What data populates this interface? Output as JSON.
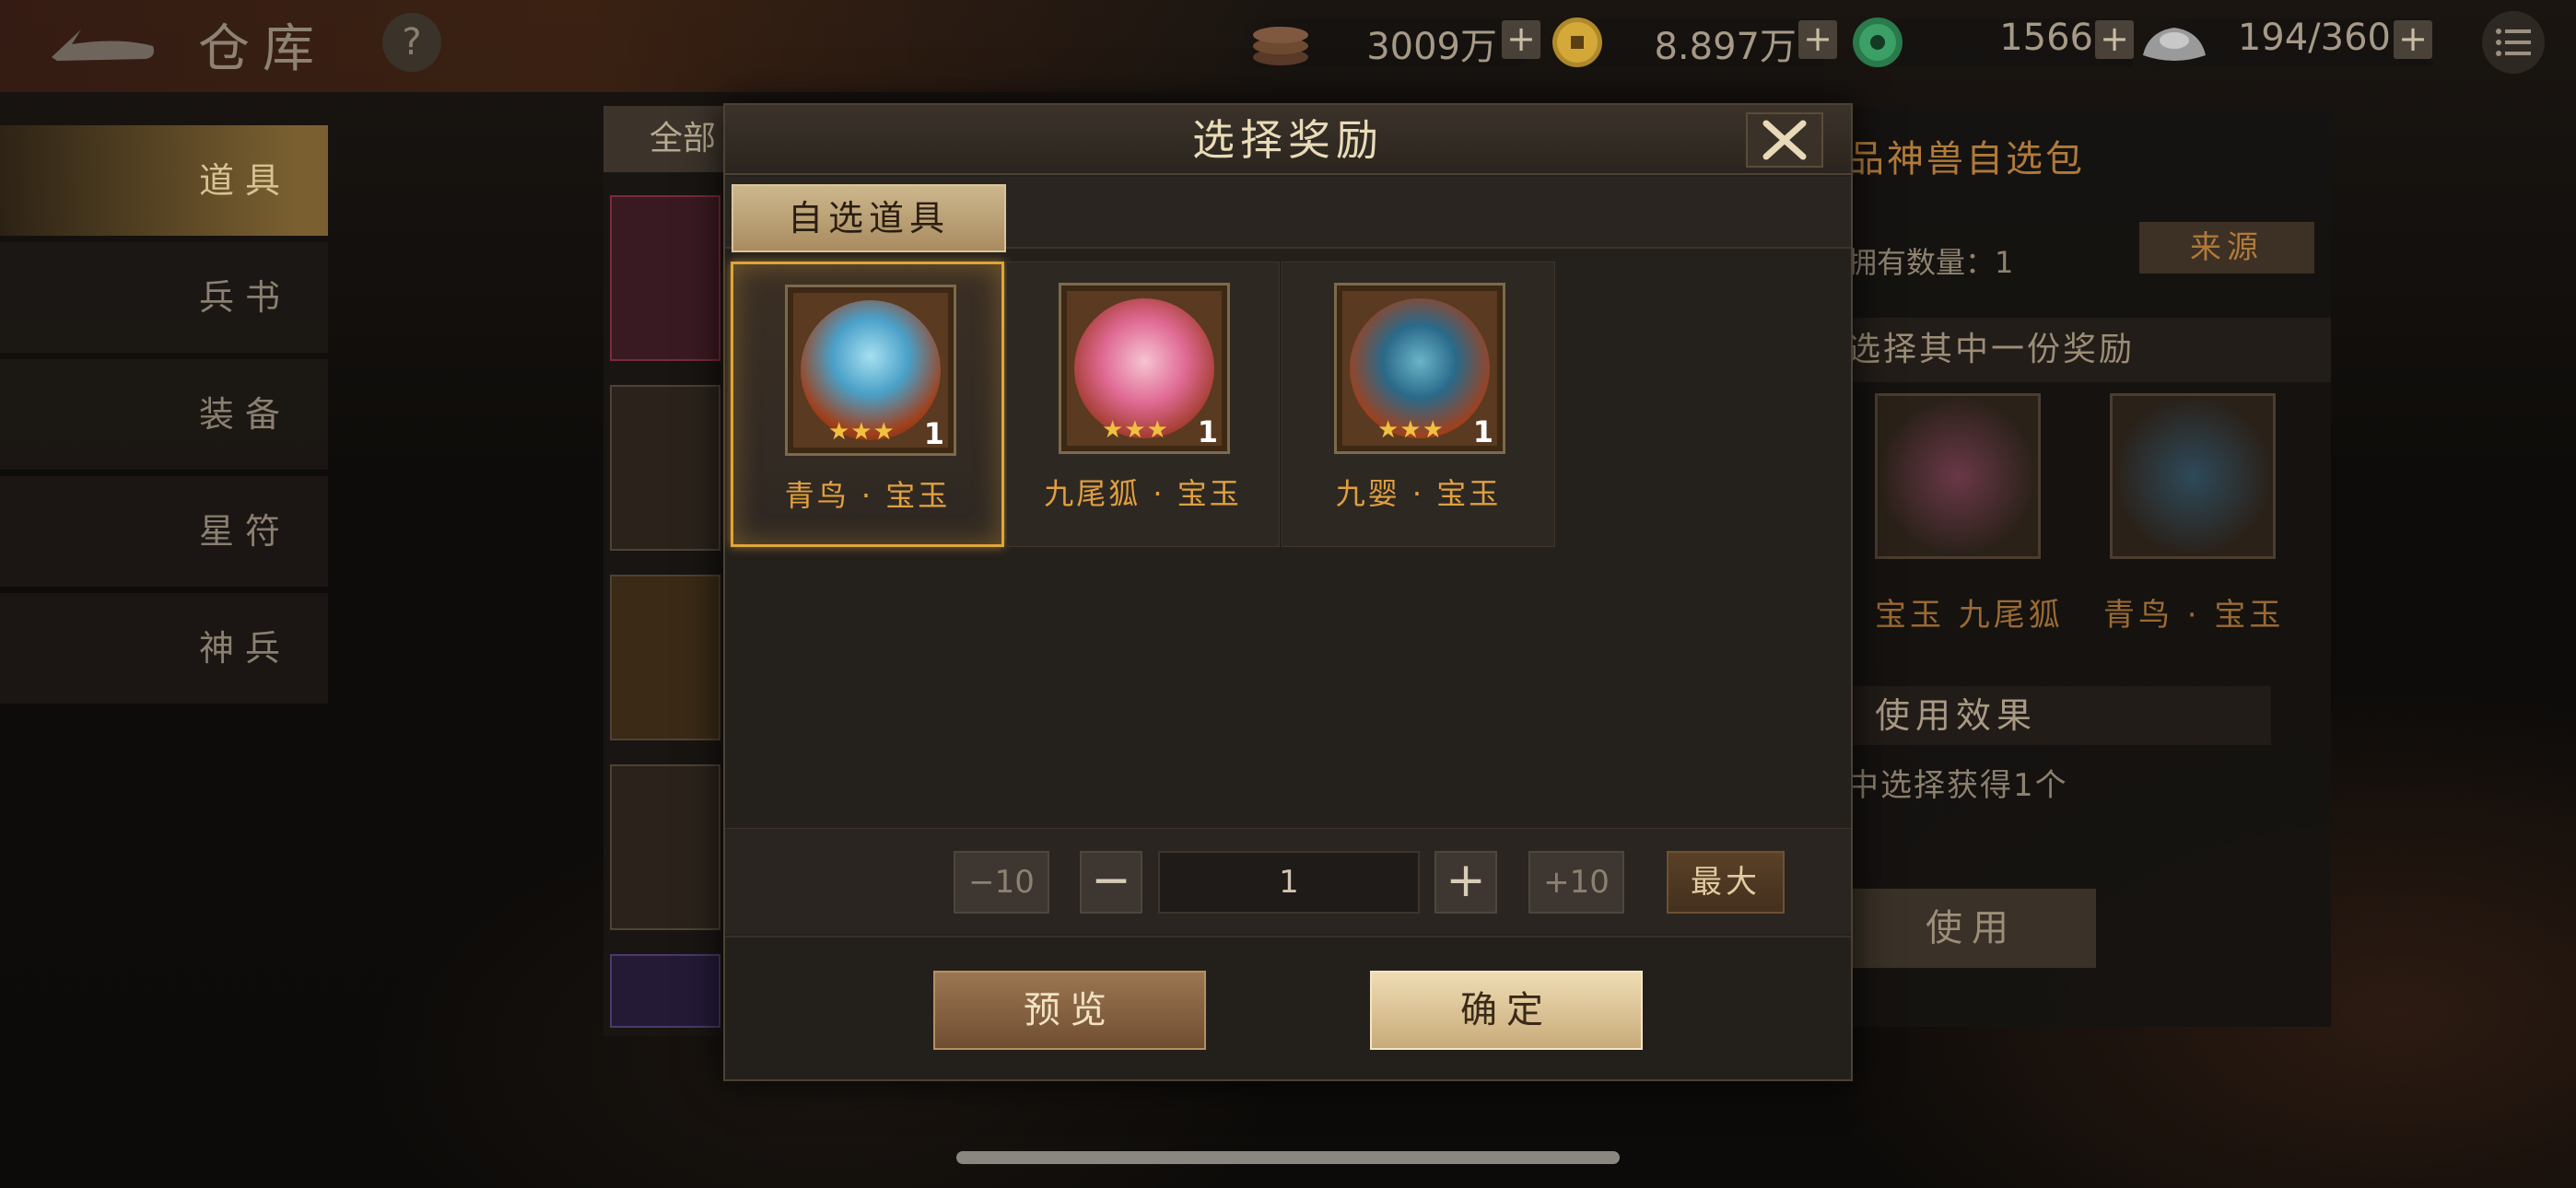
{
  "header": {
    "title": "仓库",
    "help": "?",
    "resources": [
      {
        "icon": "copper-coin-stack-icon",
        "value": "3009万"
      },
      {
        "icon": "gold-coin-icon",
        "value": "8.897万"
      },
      {
        "icon": "jade-icon",
        "value": "1566"
      },
      {
        "icon": "silver-ingot-icon",
        "value": "194/360"
      }
    ],
    "plus": "+"
  },
  "sidebar": {
    "items": [
      {
        "label": "道具",
        "active": true
      },
      {
        "label": "兵书",
        "active": false
      },
      {
        "label": "装备",
        "active": false
      },
      {
        "label": "星符",
        "active": false
      },
      {
        "label": "神兵",
        "active": false
      }
    ]
  },
  "background": {
    "filter_tab": "全部",
    "detail_title": "品神兽自选包",
    "count_label": "拥有数量：1",
    "source_button": "来源",
    "choose_hint": "选择其中一份奖励",
    "preview_items": [
      {
        "name": "宝玉 九尾狐"
      },
      {
        "name": "青鸟 · 宝玉"
      }
    ],
    "effect_header": "使用效果",
    "effect_text": "中选择获得1个",
    "use_button": "使用"
  },
  "modal": {
    "title": "选择奖励",
    "tab": "自选道具",
    "items": [
      {
        "name": "青鸟 · 宝玉",
        "stars": "★★★",
        "qty": "1",
        "selected": true,
        "creature": "blue-bird"
      },
      {
        "name": "九尾狐 · 宝玉",
        "stars": "★★★",
        "qty": "1",
        "selected": false,
        "creature": "nine-tail-fox"
      },
      {
        "name": "九婴 · 宝玉",
        "stars": "★★★",
        "qty": "1",
        "selected": false,
        "creature": "nine-headed-serpent"
      }
    ],
    "quantity": {
      "minus10": "−10",
      "minus": "−",
      "value": "1",
      "plus": "+",
      "plus10": "+10",
      "max": "最大"
    },
    "preview_button": "预览",
    "confirm_button": "确定"
  },
  "colors": {
    "accent_gold": "#e0a53a",
    "item_name": "#e0a040",
    "modal_bg": "#24201c"
  }
}
